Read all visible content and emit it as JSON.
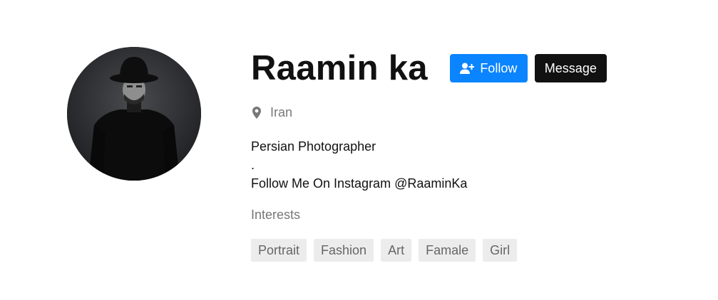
{
  "profile": {
    "name": "Raamin ka",
    "location": "Iran",
    "bio": [
      "Persian Photographer",
      ".",
      "Follow Me On Instagram @RaaminKa"
    ]
  },
  "actions": {
    "follow_label": "Follow",
    "message_label": "Message"
  },
  "interests": {
    "label": "Interests",
    "tags": [
      "Portrait",
      "Fashion",
      "Art",
      "Famale",
      "Girl"
    ]
  },
  "icons": {
    "follow": "user-plus-icon",
    "location": "map-pin-icon"
  },
  "colors": {
    "follow_button": "#0a84ff",
    "message_button": "#111111",
    "muted_text": "#777777",
    "tag_background": "#ececec"
  }
}
